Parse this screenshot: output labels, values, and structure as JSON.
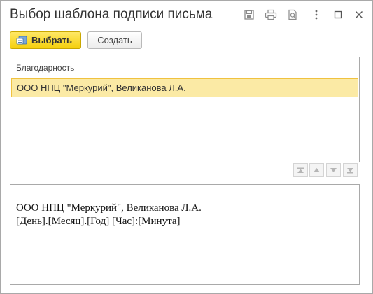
{
  "window": {
    "title": "Выбор шаблона подписи письма",
    "icons": [
      "save-icon",
      "print-icon",
      "print-preview-icon",
      "more-icon",
      "maximize-icon",
      "close-icon"
    ]
  },
  "toolbar": {
    "select_label": "Выбрать",
    "create_label": "Создать"
  },
  "list": {
    "header": "Благодарность",
    "rows": [
      {
        "text": "ООО НПЦ \"Меркурий\", Великанова Л.А.",
        "selected": true
      }
    ],
    "nav_icons": [
      "move-first-icon",
      "move-up-icon",
      "move-down-icon",
      "move-last-icon"
    ]
  },
  "preview": {
    "lines": [
      "ООО НПЦ \"Меркурий\", Великанова Л.А.",
      "[День].[Месяц].[Год] [Час]:[Минута]"
    ]
  },
  "colors": {
    "accent": "#f5cf0c",
    "selection_fill": "#fbeaa5",
    "selection_border": "#f0c23f"
  }
}
